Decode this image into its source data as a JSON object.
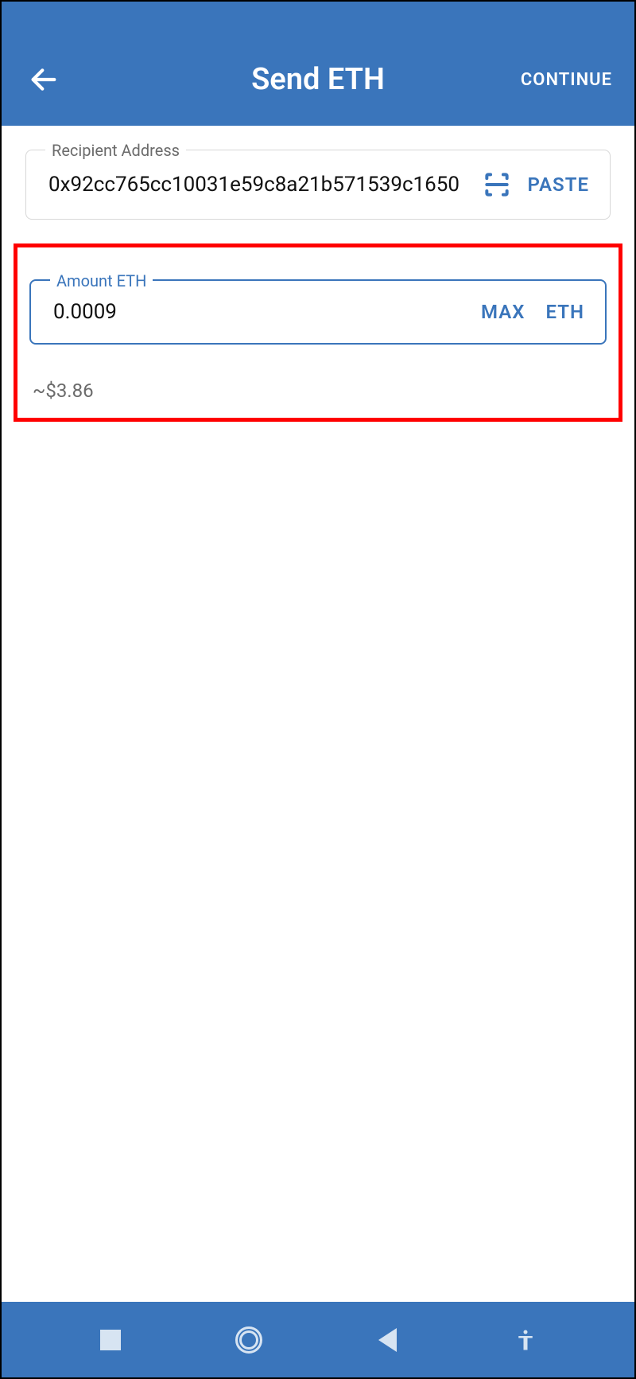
{
  "header": {
    "title": "Send ETH",
    "continue_label": "CONTINUE"
  },
  "recipient": {
    "label": "Recipient Address",
    "value": "0x92cc765cc10031e59c8a21b571539c1650",
    "paste_label": "PASTE"
  },
  "amount": {
    "label": "Amount ETH",
    "value": "0.0009",
    "max_label": "MAX",
    "token_label": "ETH",
    "fiat_value": "~$3.86"
  }
}
